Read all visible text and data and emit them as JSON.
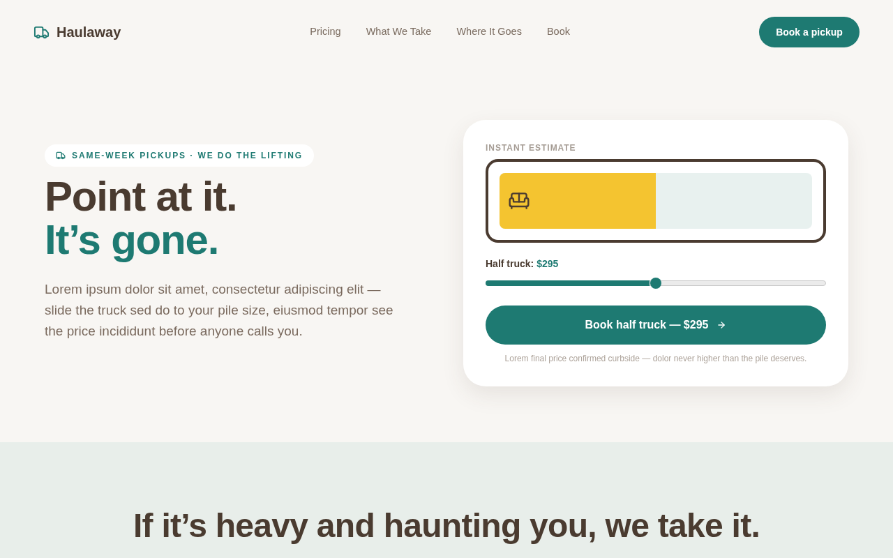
{
  "header": {
    "brand": "Haulaway",
    "nav": [
      {
        "label": "Pricing"
      },
      {
        "label": "What We Take"
      },
      {
        "label": "Where It Goes"
      },
      {
        "label": "Book"
      }
    ],
    "cta": "Book a pickup"
  },
  "hero": {
    "badge": "SAME-WEEK PICKUPS · WE DO THE LIFTING",
    "headline": [
      {
        "text": "Point at it.",
        "accent": false
      },
      {
        "text": "It’s gone.",
        "accent": true
      }
    ],
    "intro": "Lorem ipsum dolor sit amet, consectetur adipiscing elit — slide the truck sed do to your pile size, eiusmod tempor see the price incididunt before anyone calls you."
  },
  "estimator": {
    "label": "INSTANT ESTIMATE",
    "pile": {
      "level": 0.5
    },
    "size_label": "Half truck:",
    "price": "$295",
    "slider": {
      "level": 0.5
    },
    "button": "Book half truck — $295",
    "note": "Lorem final price confirmed curbside — dolor never higher than the pile deserves."
  },
  "section": {
    "heading": "If it’s heavy and haunting you, we take it."
  }
}
